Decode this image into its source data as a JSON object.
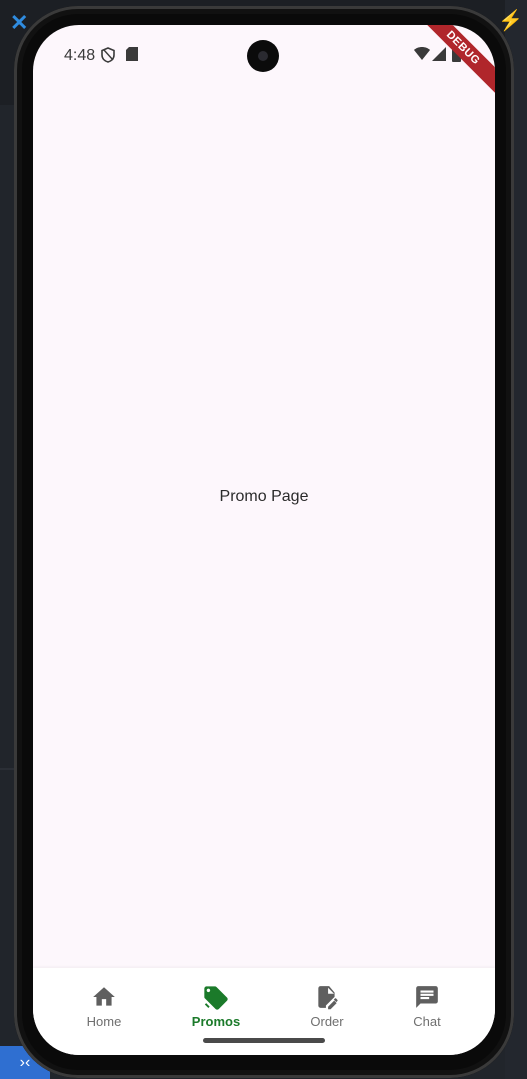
{
  "status_bar": {
    "time": "4:48",
    "icons": [
      "shield-icon",
      "sd-card-icon",
      "wifi-icon",
      "signal-icon",
      "battery-icon"
    ]
  },
  "debug_banner": "DEBUG",
  "main": {
    "text": "Promo Page"
  },
  "bottom_nav": {
    "items": [
      {
        "label": "Home",
        "icon": "home-icon"
      },
      {
        "label": "Promos",
        "icon": "tag-icon",
        "active": true
      },
      {
        "label": "Order",
        "icon": "edit-document-icon"
      },
      {
        "label": "Chat",
        "icon": "chat-icon"
      }
    ],
    "active_color": "#1b7a2a",
    "inactive_color": "#6f6f6f"
  }
}
